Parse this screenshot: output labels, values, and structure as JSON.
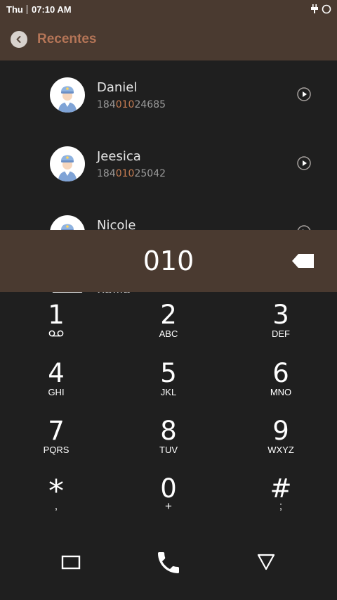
{
  "status_bar": {
    "day": "Thu",
    "time": "07:10 AM"
  },
  "app_bar": {
    "title": "Recentes"
  },
  "contacts": [
    {
      "name": "Daniel",
      "num_pre": "184",
      "num_match": "010",
      "num_post": "24685"
    },
    {
      "name": "Jeesica",
      "num_pre": "184",
      "num_match": "010",
      "num_post": "25042"
    },
    {
      "name": "Nicole",
      "num_pre": "",
      "num_match": "",
      "num_post": ""
    },
    {
      "name": "Philip",
      "num_pre": "",
      "num_match": "",
      "num_post": ""
    }
  ],
  "search": {
    "query": "010"
  },
  "keypad": {
    "k1": {
      "digit": "1",
      "sub": ""
    },
    "k2": {
      "digit": "2",
      "sub": "ABC"
    },
    "k3": {
      "digit": "3",
      "sub": "DEF"
    },
    "k4": {
      "digit": "4",
      "sub": "GHI"
    },
    "k5": {
      "digit": "5",
      "sub": "JKL"
    },
    "k6": {
      "digit": "6",
      "sub": "MNO"
    },
    "k7": {
      "digit": "7",
      "sub": "PQRS"
    },
    "k8": {
      "digit": "8",
      "sub": "TUV"
    },
    "k9": {
      "digit": "9",
      "sub": "WXYZ"
    },
    "kstar": {
      "digit": "*",
      "sub": ","
    },
    "k0": {
      "digit": "0",
      "sub": "+"
    },
    "khash": {
      "digit": "#",
      "sub": ";"
    }
  },
  "icons": {
    "status": [
      "usb-plug-icon",
      "circle-icon"
    ],
    "app_bar": "back-arrow-icon",
    "contact_row": [
      "avatar-icon",
      "play-icon"
    ],
    "search": "backspace-icon",
    "keypad_1": "voicemail-icon",
    "nav": [
      "recents-square-icon",
      "phone-call-icon",
      "back-triangle-icon"
    ]
  },
  "colors": {
    "bar_brown": "#4a3a30",
    "accent": "#b57557",
    "background": "#1f1f1f"
  }
}
